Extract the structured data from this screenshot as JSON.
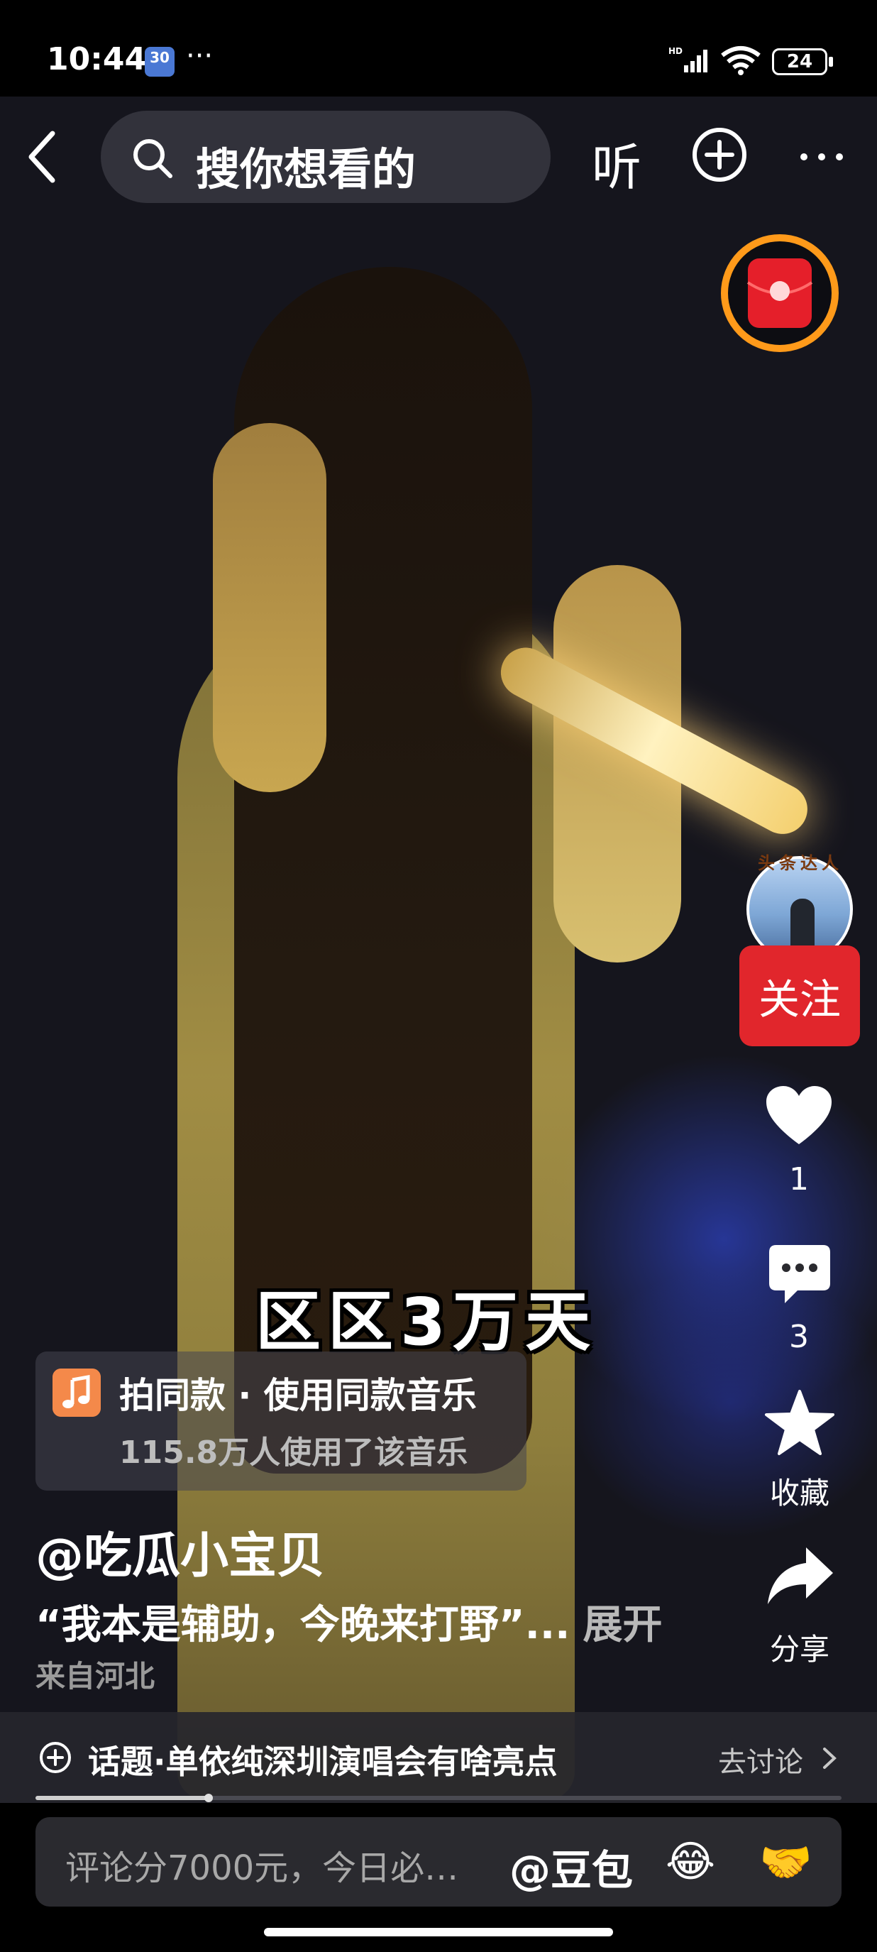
{
  "status_bar": {
    "time": "10:44",
    "calendar_day": "30",
    "dots": "···",
    "battery": "24"
  },
  "nav": {
    "search_placeholder": "搜你想看的",
    "listen_label": "听"
  },
  "video": {
    "subtitle": "区区3万天"
  },
  "sidebar": {
    "badge": "头条达人",
    "follow_label": "关注",
    "like_count": "1",
    "comment_count": "3",
    "favorite_label": "收藏",
    "share_label": "分享"
  },
  "music": {
    "title": "拍同款 · 使用同款音乐",
    "usage": "115.8万人使用了该音乐"
  },
  "post": {
    "author": "@吃瓜小宝贝",
    "caption": "“我本是辅助，今晚来打野”...",
    "expand_label": "展开",
    "location": "来自河北"
  },
  "topic": {
    "text": "话题·单依纯深圳演唱会有啥亮点",
    "action": "去讨论"
  },
  "progress": {
    "fraction": 0.215
  },
  "comment_bar": {
    "placeholder": "评论分7000元，今日必…",
    "mention": "@豆包",
    "emoji_laugh": "😂",
    "emoji_handshake": "🤝"
  },
  "colors": {
    "follow_button": "#e1262c",
    "music_icon": "#f4894a",
    "redpacket_ring": "#ff9a1a"
  },
  "icons": [
    "back-icon",
    "search-icon",
    "add-icon",
    "more-icon",
    "redpacket-icon",
    "heart-icon",
    "comment-icon",
    "star-icon",
    "share-icon",
    "topic-add-icon",
    "chevron-right-icon",
    "music-note-icon"
  ]
}
